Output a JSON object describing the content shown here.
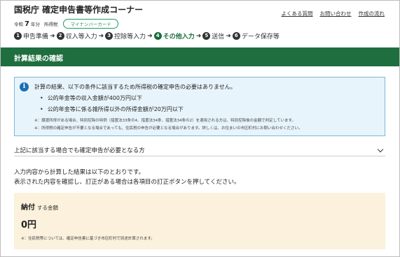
{
  "header": {
    "title": "国税庁  確定申告書等作成コーナー",
    "era": "令和",
    "year": "7",
    "year_suffix": "年分",
    "tax_type": "所得税",
    "mynumber_badge": "マイナンバーカード"
  },
  "top_links": [
    "よくある質問",
    "お問い合わせ",
    "作成の流れ"
  ],
  "steps": [
    {
      "num": "1",
      "label": "申告準備"
    },
    {
      "num": "2",
      "label": "収入等入力"
    },
    {
      "num": "3",
      "label": "控除等入力"
    },
    {
      "num": "4",
      "label": "その他入力",
      "active": true
    },
    {
      "num": "5",
      "label": "送信"
    },
    {
      "num": "6",
      "label": "データ保存等"
    }
  ],
  "section_title": "計算結果の確認",
  "info": {
    "main": "計算の結果、以下の条件に該当するため所得税の確定申告の必要はありません。",
    "bullets": [
      "公的年金等の収入金額が400万円以下",
      "公的年金等に係る雑所得以外の所得金額が20万円以下"
    ],
    "notes": [
      "※：譲渡所得がある場合、特別控除の特例（措置法33条の4、措置法34条、措置法34条の2）を適用される方は、特別控除後の金額で判定しています。",
      "※：所得税の確定申告が不要となる場合であっても、住民税の申告が必要となる場合があります。詳しくは、お住まいの市区町村にお問い合わせください。"
    ]
  },
  "accordion_label": "上記に該当する場合でも確定申告が必要となる方",
  "description": [
    "入力内容から計算した結果は以下のとおりです。",
    "表示された内容を確認し、訂正がある場合は各項目の訂正ボタンを押してください。"
  ],
  "payment": {
    "title_strong": "納付",
    "title_sub": "する金額",
    "amount": "0円",
    "note": "※：住民税等については、確定申告書に基づき市区町村で別途計算されます。"
  }
}
